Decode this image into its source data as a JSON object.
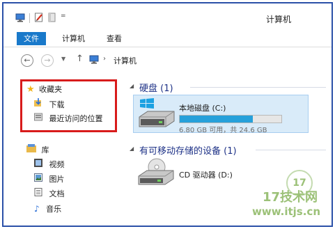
{
  "window": {
    "title": "计算机"
  },
  "ribbon": {
    "tabs": [
      "文件",
      "计算机",
      "查看"
    ]
  },
  "address": {
    "path": "计算机"
  },
  "sidebar": {
    "favorites": {
      "label": "收藏夹",
      "items": [
        "下载",
        "最近访问的位置"
      ]
    },
    "libraries": {
      "label": "库",
      "items": [
        "视频",
        "图片",
        "文档",
        "音乐"
      ]
    }
  },
  "content": {
    "hard_disks": {
      "header": "硬盘 (1)",
      "drive": {
        "name": "本地磁盘 (C:)",
        "usage": "6.80 GB 可用，共 24.6 GB",
        "used_fraction": 0.72
      }
    },
    "removable": {
      "header": "有可移动存储的设备 (1)",
      "drive": {
        "name": "CD 驱动器 (D:)"
      }
    }
  },
  "watermark": {
    "brand": "17技术网",
    "url": "www.itjs.cn"
  },
  "colors": {
    "accent": "#1979ca",
    "highlight_border": "#d81b1b",
    "header_text": "#1e3287",
    "drive_fill": "#26a0da"
  }
}
